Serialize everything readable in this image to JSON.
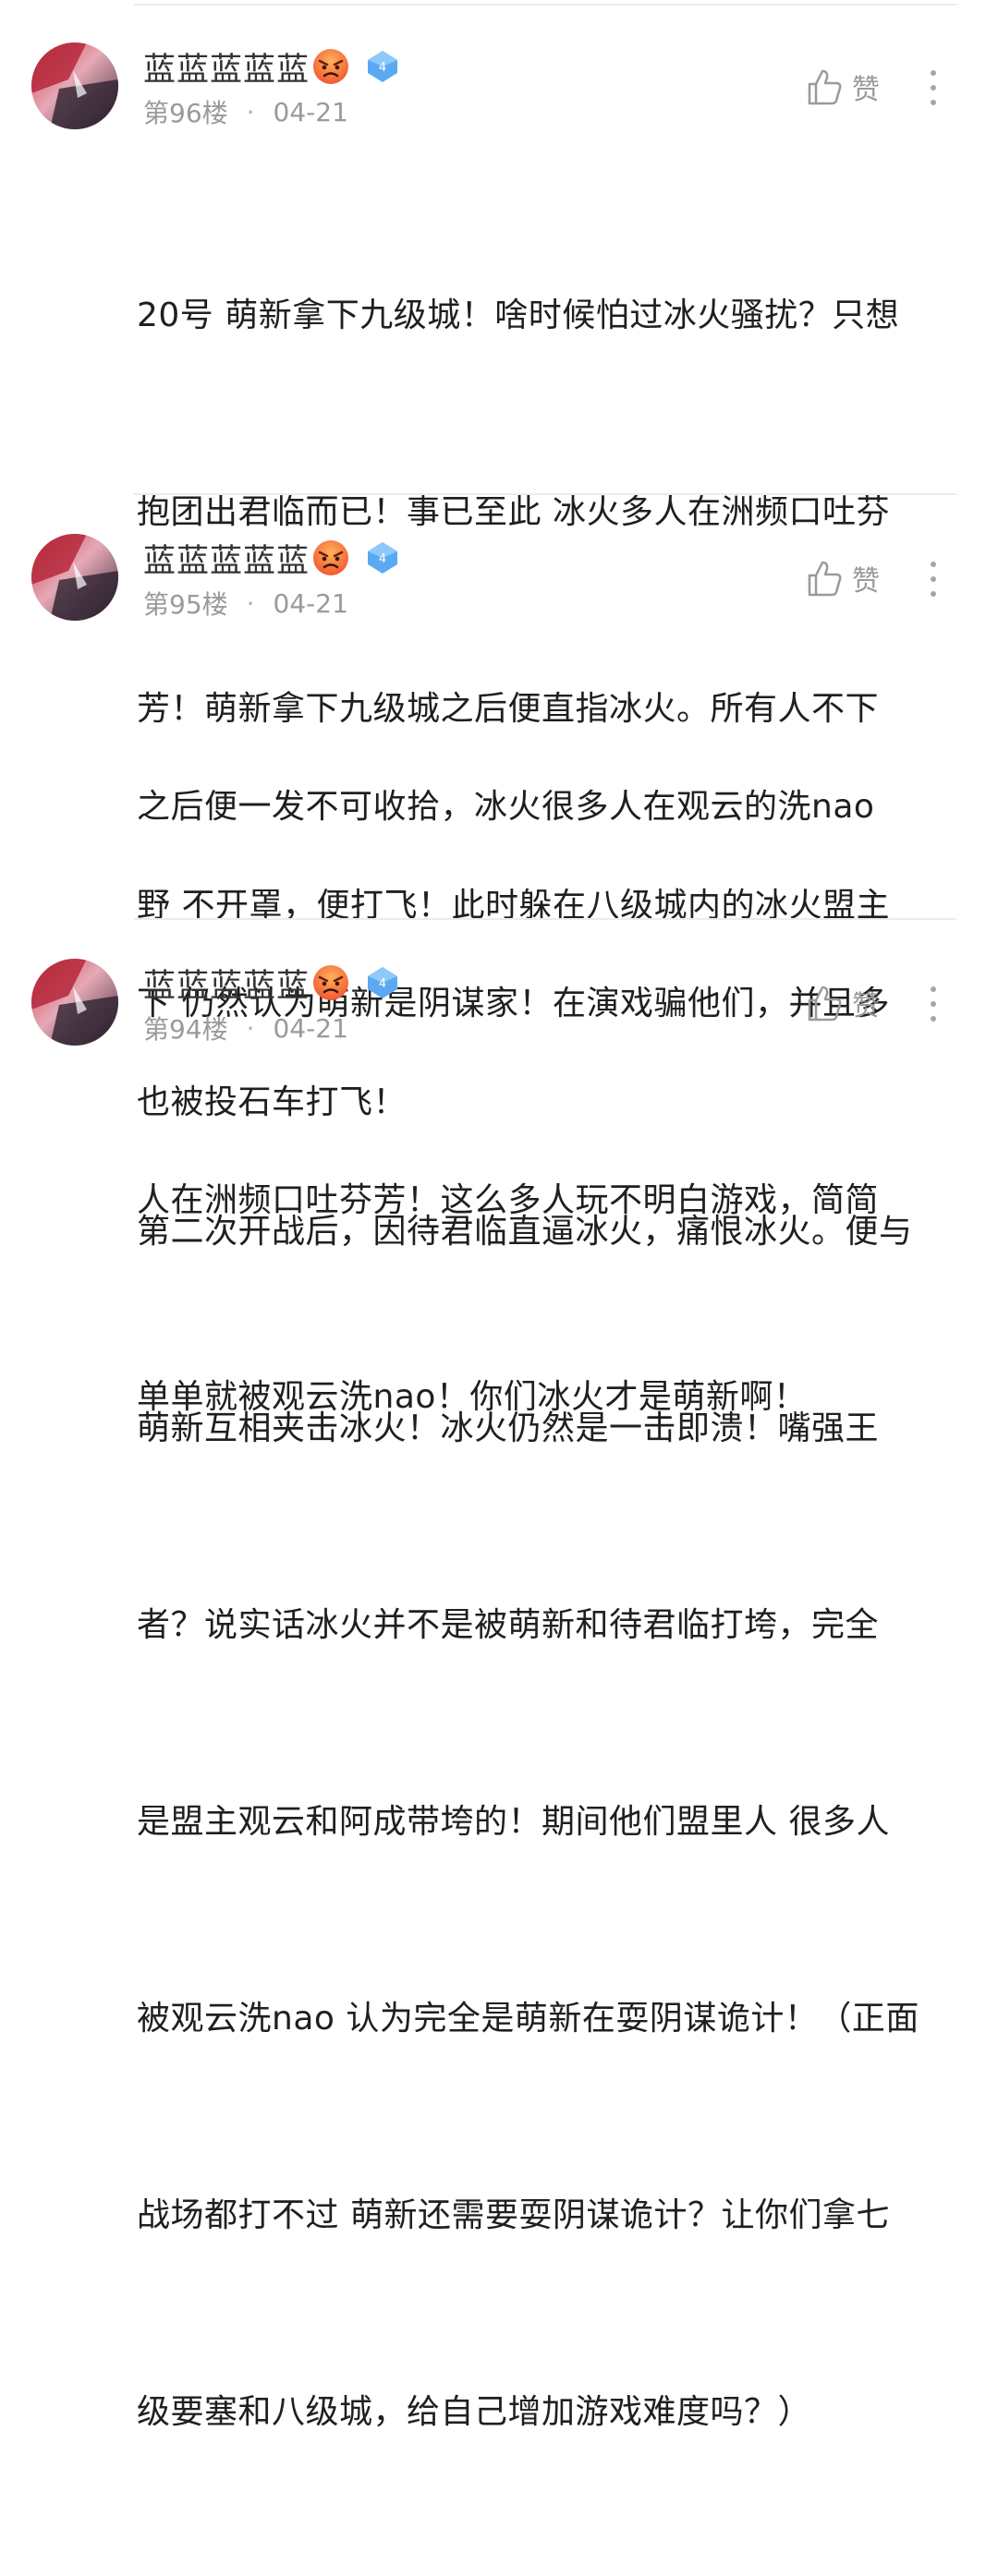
{
  "comments": [
    {
      "username": "蓝蓝蓝蓝蓝",
      "emoji_icon": "angry-face-icon",
      "level_icon": "diamond-level-icon",
      "level": "4",
      "floor": "第96楼",
      "separator": "·",
      "date": "04-21",
      "like_label": "赞",
      "body_lines": [
        "20号 萌新拿下九级城！啥时候怕过冰火骚扰？只想",
        "抱团出君临而已！事已至此 冰火多人在洲频口吐芬",
        "芳！萌新拿下九级城之后便直指冰火。所有人不下",
        "野 不开罩，便打飞！此时躲在八级城内的冰火盟主",
        "也被投石车打飞！"
      ]
    },
    {
      "username": "蓝蓝蓝蓝蓝",
      "emoji_icon": "angry-face-icon",
      "level_icon": "diamond-level-icon",
      "level": "4",
      "floor": "第95楼",
      "separator": "·",
      "date": "04-21",
      "like_label": "赞",
      "body_lines": [
        "之后便一发不可收拾，冰火很多人在观云的洗nao",
        "下 仍然认为萌新是阴谋家！在演戏骗他们，并且多",
        "人在洲频口吐芬芳！这么多人玩不明白游戏，简简",
        "单单就被观云洗nao！你们冰火才是萌新啊！"
      ]
    },
    {
      "username": "蓝蓝蓝蓝蓝",
      "emoji_icon": "angry-face-icon",
      "level_icon": "diamond-level-icon",
      "level": "4",
      "floor": "第94楼",
      "separator": "·",
      "date": "04-21",
      "like_label": "赞",
      "body_lines": [
        "第二次开战后，因待君临直逼冰火，痛恨冰火。便与",
        "萌新互相夹击冰火！冰火仍然是一击即溃！嘴强王",
        "者？说实话冰火并不是被萌新和待君临打垮，完全",
        "是盟主观云和阿成带垮的！期间他们盟里人 很多人",
        "被观云洗nao 认为完全是萌新在耍阴谋诡计！（正面",
        "战场都打不过 萌新还需要耍阴谋诡计？让你们拿七",
        "级要塞和八级城，给自己增加游戏难度吗？）"
      ]
    }
  ],
  "colors": {
    "username": "#333333",
    "meta": "#9a9a9a",
    "body": "#1f1f1f",
    "divider": "#ececec",
    "level_badge": "#5aa9f2",
    "emoji": "#f26a3b"
  }
}
